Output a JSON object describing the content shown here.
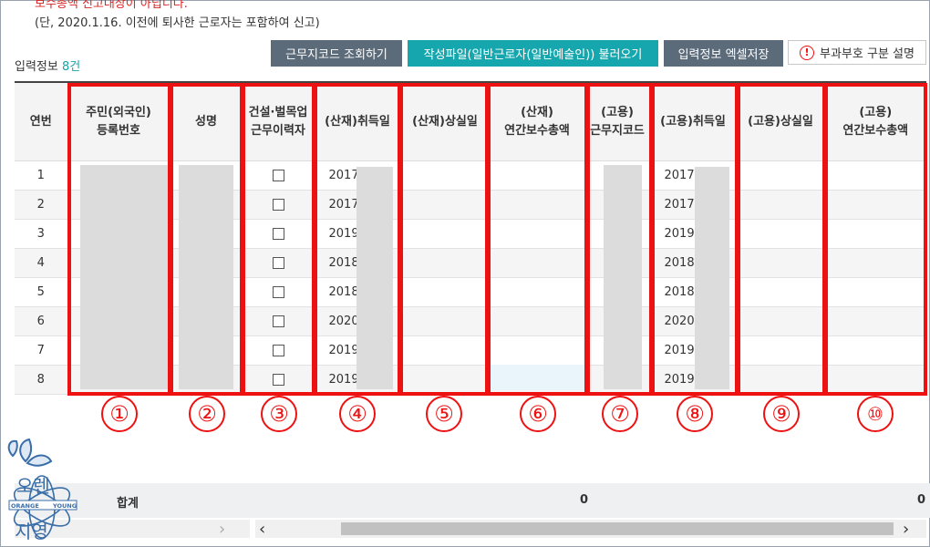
{
  "notice": {
    "line1": "보수총액 신고대상이 아닙니다.",
    "line2": "(단, 2020.1.16. 이전에 퇴사한 근로자는 포함하여 신고)"
  },
  "input_info": {
    "label": "입력정보",
    "count": "8건"
  },
  "buttons": {
    "workplace_code": "근무지코드 조회하기",
    "load_file": "작성파일(일반근로자(일반예술인)) 불러오기",
    "excel_save": "입력정보 엑셀저장",
    "explain": "부과부호 구분 설명"
  },
  "table": {
    "headers": {
      "c0": "연번",
      "c1a": "주민(외국인)",
      "c1b": "등록번호",
      "c2": "성명",
      "c3a": "건설·벌목업",
      "c3b": "근무이력자",
      "c4": "(산재)취득일",
      "c5": "(산재)상실일",
      "c6a": "(산재)",
      "c6b": "연간보수총액",
      "c7a": "(고용)",
      "c7b": "근무지코드",
      "c8": "(고용)취득일",
      "c9": "(고용)상실일",
      "c10a": "(고용)",
      "c10b": "연간보수총액"
    },
    "rows": [
      {
        "no": "1",
        "sanjae_date": "2017-",
        "goyong_date": "2017-"
      },
      {
        "no": "2",
        "sanjae_date": "2017-",
        "goyong_date": "2017-"
      },
      {
        "no": "3",
        "sanjae_date": "2019-",
        "goyong_date": "2019-"
      },
      {
        "no": "4",
        "sanjae_date": "2018-",
        "goyong_date": "2018-"
      },
      {
        "no": "5",
        "sanjae_date": "2018-",
        "goyong_date": "2018-"
      },
      {
        "no": "6",
        "sanjae_date": "2020-",
        "goyong_date": "2020-"
      },
      {
        "no": "7",
        "sanjae_date": "2019-",
        "goyong_date": "2019-"
      },
      {
        "no": "8",
        "sanjae_date": "2019-",
        "goyong_date": "2019-"
      }
    ]
  },
  "annotations": [
    "①",
    "②",
    "③",
    "④",
    "⑤",
    "⑥",
    "⑦",
    "⑧",
    "⑨",
    "⑩"
  ],
  "summary": {
    "label": "합계",
    "sanjae_total": "0",
    "goyong_total": "0"
  },
  "logo": {
    "top": "오렌",
    "bottom": "지영",
    "band_left": "ORANGE",
    "band_right": "YOUNG"
  },
  "colors": {
    "accent_red": "#ee1111",
    "teal": "#15a7ad",
    "slate": "#5c6b7a"
  }
}
